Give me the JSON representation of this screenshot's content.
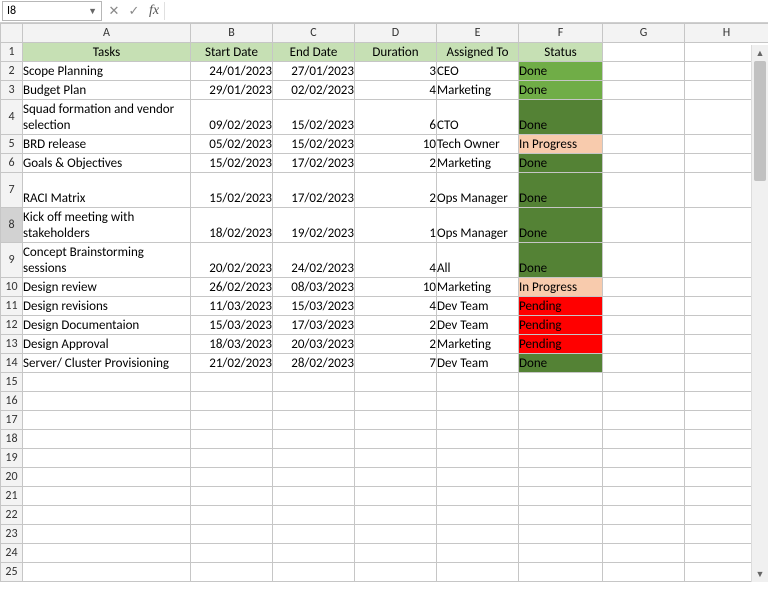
{
  "formula_bar": {
    "name_box": "I8",
    "cancel": "✕",
    "confirm": "✓",
    "fx": "fx",
    "formula": ""
  },
  "active_row": 8,
  "columns": [
    "",
    "A",
    "B",
    "C",
    "D",
    "E",
    "F",
    "G",
    "H"
  ],
  "headers": {
    "A": "Tasks",
    "B": "Start Date",
    "C": "End Date",
    "D": "Duration",
    "E": "Assigned To",
    "F": "Status"
  },
  "rows": [
    {
      "n": 2,
      "h": "h1",
      "task": "Scope Planning",
      "start": "24/01/2023",
      "end": "27/01/2023",
      "dur": "3",
      "who": "CEO",
      "status": "Done",
      "scls": "done-light"
    },
    {
      "n": 3,
      "h": "h1",
      "task": "Budget Plan",
      "start": "29/01/2023",
      "end": "02/02/2023",
      "dur": "4",
      "who": "Marketing",
      "status": "Done",
      "scls": "done-light"
    },
    {
      "n": 4,
      "h": "h2",
      "task": "Squad formation and vendor selection",
      "start": "09/02/2023",
      "end": "15/02/2023",
      "dur": "6",
      "who": "CTO",
      "status": "Done",
      "scls": "done-dark"
    },
    {
      "n": 5,
      "h": "h1",
      "task": "BRD release",
      "start": "05/02/2023",
      "end": "15/02/2023",
      "dur": "10",
      "who": "Tech Owner",
      "status": "In Progress",
      "scls": "inprog"
    },
    {
      "n": 6,
      "h": "h1",
      "task": "Goals & Objectives",
      "start": "15/02/2023",
      "end": "17/02/2023",
      "dur": "2",
      "who": "Marketing",
      "status": "Done",
      "scls": "done-dark"
    },
    {
      "n": 7,
      "h": "h2",
      "task": "RACI Matrix",
      "start": "15/02/2023",
      "end": "17/02/2023",
      "dur": "2",
      "who": "Ops Manager",
      "status": "Done",
      "scls": "done-dark"
    },
    {
      "n": 8,
      "h": "h2",
      "task": "Kick off meeting with stakeholders",
      "start": "18/02/2023",
      "end": "19/02/2023",
      "dur": "1",
      "who": "Ops Manager",
      "status": "Done",
      "scls": "done-dark"
    },
    {
      "n": 9,
      "h": "h2",
      "task": "Concept Brainstorming sessions",
      "start": "20/02/2023",
      "end": "24/02/2023",
      "dur": "4",
      "who": "All",
      "status": "Done",
      "scls": "done-dark"
    },
    {
      "n": 10,
      "h": "h1",
      "task": "Design review",
      "start": "26/02/2023",
      "end": "08/03/2023",
      "dur": "10",
      "who": "Marketing",
      "status": "In Progress",
      "scls": "inprog"
    },
    {
      "n": 11,
      "h": "h1",
      "task": "Design revisions",
      "start": "11/03/2023",
      "end": "15/03/2023",
      "dur": "4",
      "who": "Dev Team",
      "status": "Pending",
      "scls": "pending"
    },
    {
      "n": 12,
      "h": "h1",
      "task": "Design Documentaion",
      "start": "15/03/2023",
      "end": "17/03/2023",
      "dur": "2",
      "who": "Dev Team",
      "status": "Pending",
      "scls": "pending"
    },
    {
      "n": 13,
      "h": "h1",
      "task": "Design Approval",
      "start": "18/03/2023",
      "end": "20/03/2023",
      "dur": "2",
      "who": "Marketing",
      "status": "Pending",
      "scls": "pending"
    },
    {
      "n": 14,
      "h": "h1",
      "task": "Server/ Cluster Provisioning",
      "start": "21/02/2023",
      "end": "28/02/2023",
      "dur": "7",
      "who": "Dev Team",
      "status": "Done",
      "scls": "done-dark"
    }
  ],
  "empty_rows": [
    15,
    16,
    17,
    18,
    19,
    20,
    21,
    22,
    23,
    24,
    25
  ],
  "chart_data": {
    "type": "table",
    "title": "Project Tasks Schedule",
    "columns": [
      "Tasks",
      "Start Date",
      "End Date",
      "Duration",
      "Assigned To",
      "Status"
    ],
    "records": [
      [
        "Scope Planning",
        "24/01/2023",
        "27/01/2023",
        3,
        "CEO",
        "Done"
      ],
      [
        "Budget Plan",
        "29/01/2023",
        "02/02/2023",
        4,
        "Marketing",
        "Done"
      ],
      [
        "Squad formation and vendor selection",
        "09/02/2023",
        "15/02/2023",
        6,
        "CTO",
        "Done"
      ],
      [
        "BRD release",
        "05/02/2023",
        "15/02/2023",
        10,
        "Tech Owner",
        "In Progress"
      ],
      [
        "Goals & Objectives",
        "15/02/2023",
        "17/02/2023",
        2,
        "Marketing",
        "Done"
      ],
      [
        "RACI Matrix",
        "15/02/2023",
        "17/02/2023",
        2,
        "Ops Manager",
        "Done"
      ],
      [
        "Kick off meeting with stakeholders",
        "18/02/2023",
        "19/02/2023",
        1,
        "Ops Manager",
        "Done"
      ],
      [
        "Concept Brainstorming sessions",
        "20/02/2023",
        "24/02/2023",
        4,
        "All",
        "Done"
      ],
      [
        "Design review",
        "26/02/2023",
        "08/03/2023",
        10,
        "Marketing",
        "In Progress"
      ],
      [
        "Design revisions",
        "11/03/2023",
        "15/03/2023",
        4,
        "Dev Team",
        "Pending"
      ],
      [
        "Design Documentaion",
        "15/03/2023",
        "17/03/2023",
        2,
        "Dev Team",
        "Pending"
      ],
      [
        "Design Approval",
        "18/03/2023",
        "20/03/2023",
        2,
        "Marketing",
        "Pending"
      ],
      [
        "Server/ Cluster Provisioning",
        "21/02/2023",
        "28/02/2023",
        7,
        "Dev Team",
        "Done"
      ]
    ]
  }
}
